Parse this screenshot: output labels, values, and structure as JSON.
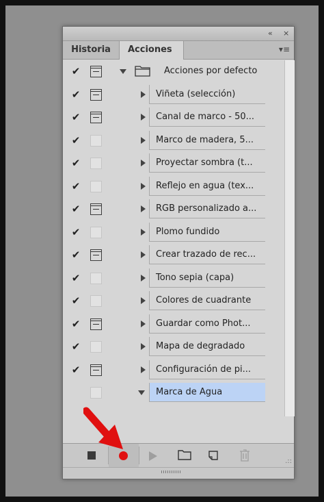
{
  "window": {
    "collapse_glyph": "«",
    "close_glyph": "×"
  },
  "tabs": [
    {
      "label": "Historia",
      "active": false
    },
    {
      "label": "Acciones",
      "active": true
    }
  ],
  "tab_menu_glyph": "▾≡",
  "actions": [
    {
      "label": "Acciones por defecto",
      "checked": true,
      "dialog": true,
      "type": "set",
      "expanded": true
    },
    {
      "label": "Viñeta (selección)",
      "checked": true,
      "dialog": true,
      "type": "action"
    },
    {
      "label": "Canal de marco - 50...",
      "checked": true,
      "dialog": true,
      "type": "action"
    },
    {
      "label": "Marco de madera, 5...",
      "checked": true,
      "dialog": false,
      "type": "action"
    },
    {
      "label": "Proyectar sombra (t...",
      "checked": true,
      "dialog": false,
      "type": "action"
    },
    {
      "label": "Reflejo en agua (tex...",
      "checked": true,
      "dialog": false,
      "type": "action"
    },
    {
      "label": "RGB personalizado a...",
      "checked": true,
      "dialog": true,
      "type": "action"
    },
    {
      "label": "Plomo fundido",
      "checked": true,
      "dialog": false,
      "type": "action"
    },
    {
      "label": "Crear trazado de rec...",
      "checked": true,
      "dialog": true,
      "type": "action"
    },
    {
      "label": "Tono sepia (capa)",
      "checked": true,
      "dialog": false,
      "type": "action"
    },
    {
      "label": "Colores de cuadrante",
      "checked": true,
      "dialog": false,
      "type": "action"
    },
    {
      "label": "Guardar como Phot...",
      "checked": true,
      "dialog": true,
      "type": "action"
    },
    {
      "label": "Mapa de degradado",
      "checked": true,
      "dialog": false,
      "type": "action"
    },
    {
      "label": "Configuración de pi...",
      "checked": true,
      "dialog": true,
      "type": "action"
    },
    {
      "label": "Marca de Agua",
      "checked": false,
      "dialog": false,
      "type": "action",
      "expanded": true,
      "selected": true
    }
  ],
  "toolbar": [
    {
      "name": "stop-button",
      "icon": "stop-icon"
    },
    {
      "name": "record-button",
      "icon": "record-icon",
      "color": "#e01010"
    },
    {
      "name": "play-button",
      "icon": "play-icon"
    },
    {
      "name": "new-set-button",
      "icon": "folder-icon"
    },
    {
      "name": "new-action-button",
      "icon": "new-page-icon"
    },
    {
      "name": "delete-button",
      "icon": "trash-icon"
    }
  ],
  "colors": {
    "selection": "#bcd3f5",
    "annotation_arrow": "#e01010"
  }
}
